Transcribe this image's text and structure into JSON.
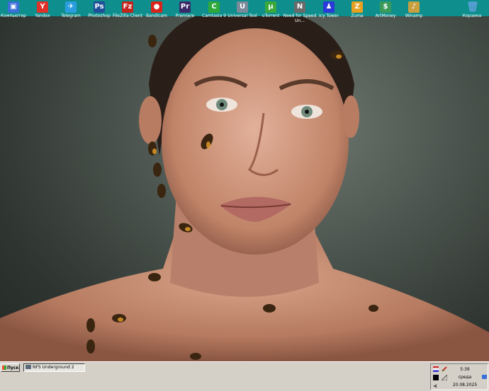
{
  "desktop": {
    "icons": [
      {
        "label": "Компьютер",
        "icon": "computer-icon",
        "color": "#3a6fd8"
      },
      {
        "label": "Yandex",
        "icon": "yandex-browser-icon",
        "color": "#e0302a"
      },
      {
        "label": "Telegram",
        "icon": "telegram-icon",
        "color": "#2a9de0"
      },
      {
        "label": "Photoshop",
        "icon": "photoshop-icon",
        "color": "#1f4f9a"
      },
      {
        "label": "FileZilla Client",
        "icon": "filezilla-icon",
        "color": "#c4241c"
      },
      {
        "label": "Bandicam",
        "icon": "bandicam-icon",
        "color": "#d8241c"
      },
      {
        "label": "Premiere",
        "icon": "premiere-icon",
        "color": "#3a2a6a"
      },
      {
        "label": "Camtasia 9",
        "icon": "camtasia-icon",
        "color": "#2fa83a"
      },
      {
        "label": "Universal Tool",
        "icon": "universal-tool-icon",
        "color": "#7a8a9a"
      },
      {
        "label": "uTorrent",
        "icon": "utorrent-icon",
        "color": "#3aa83a"
      },
      {
        "label": "Need for Speed Un...",
        "icon": "nfs-icon",
        "color": "#6a6a6a"
      },
      {
        "label": "Icy Tower",
        "icon": "icy-tower-icon",
        "color": "#2a3ad8"
      },
      {
        "label": "Zuma",
        "icon": "zuma-icon",
        "color": "#e8a020"
      },
      {
        "label": "ArtMoney",
        "icon": "artmoney-icon",
        "color": "#3a9a5a"
      },
      {
        "label": "Winamp",
        "icon": "winamp-icon",
        "color": "#c8a040"
      }
    ],
    "recycle_bin": {
      "label": "Корзина",
      "icon": "recycle-bin-icon",
      "color": "#5aa0d8"
    }
  },
  "taskbar": {
    "start_label": "Пуск",
    "task_items": [
      {
        "label": "NFS Underground 2"
      }
    ],
    "tray": {
      "time": "5:39",
      "day": "среда",
      "date": "20.08.2025",
      "language_icon": "language-flag-icon",
      "volume_icon": "volume-icon",
      "network_icon": "network-icon",
      "color_icon": "color-picker-icon",
      "show_desktop_icon": "show-desktop-icon"
    }
  }
}
